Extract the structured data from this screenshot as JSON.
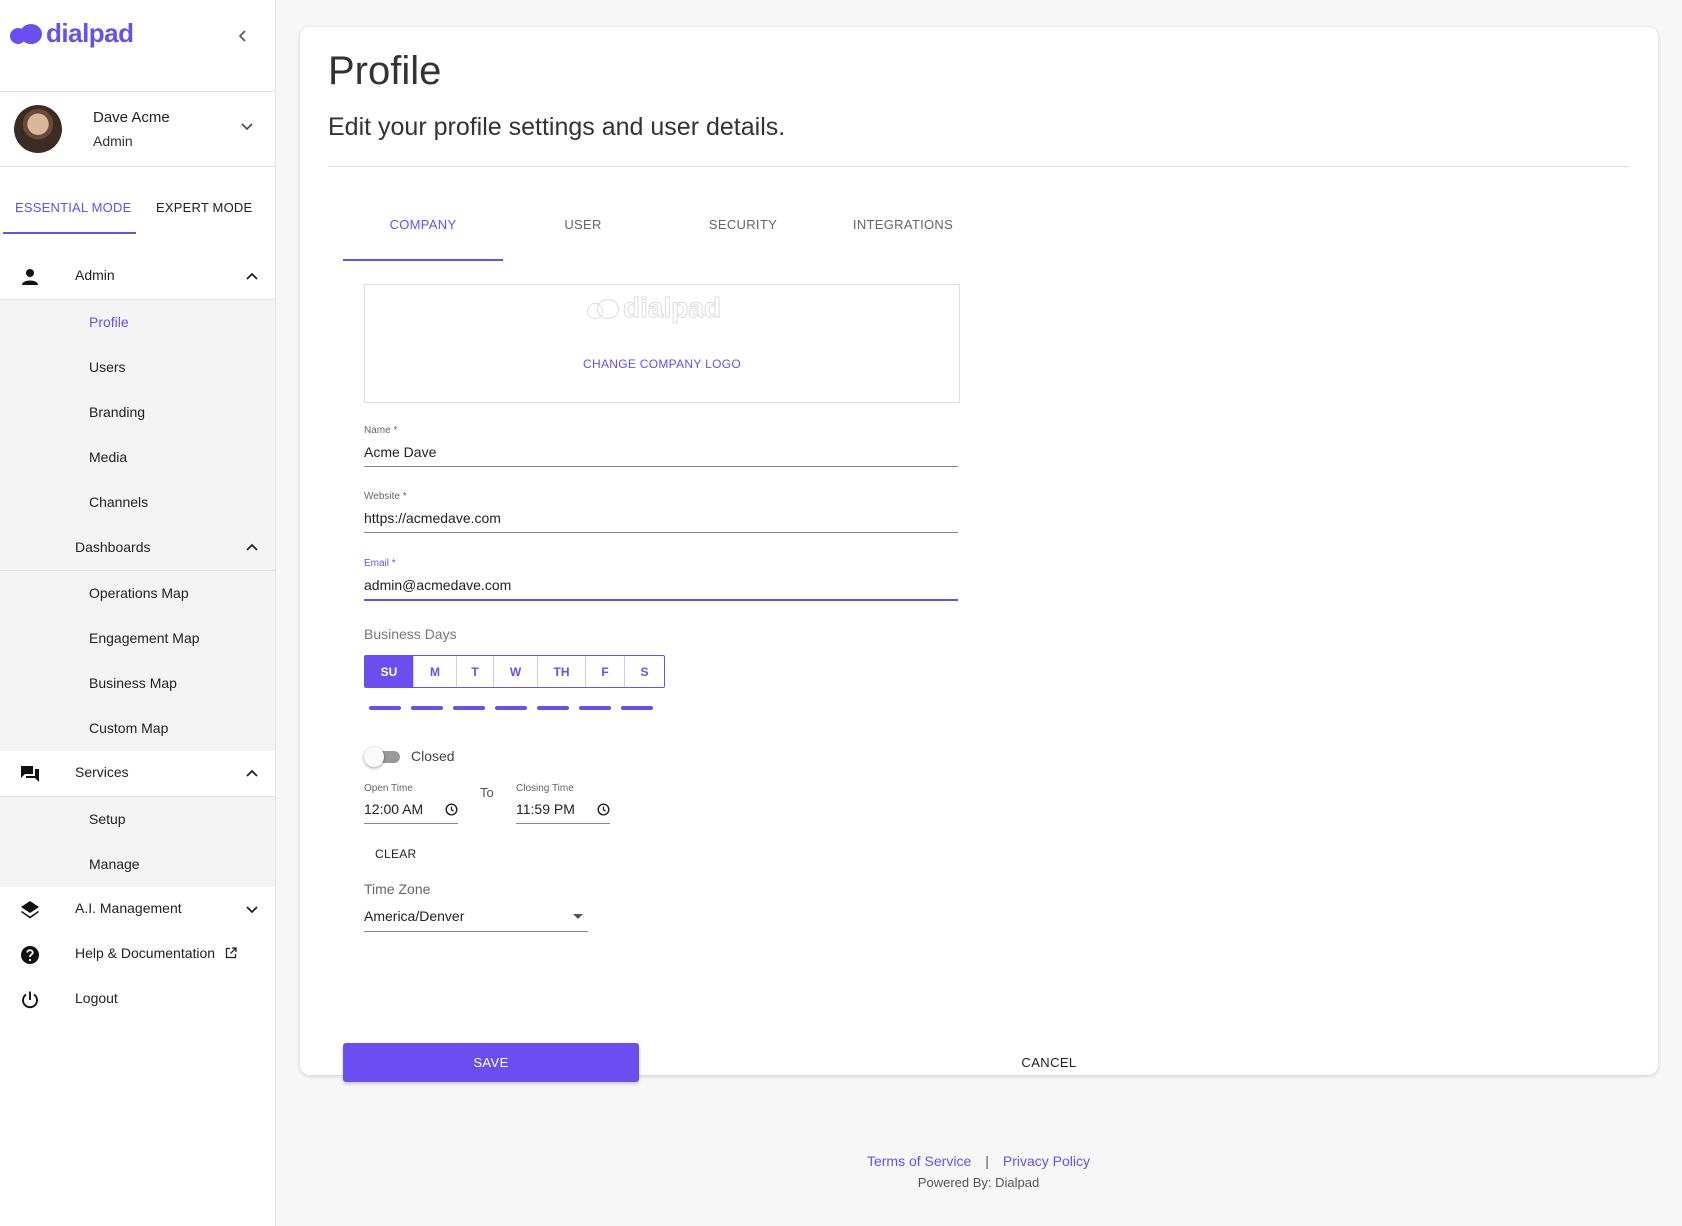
{
  "brand": {
    "name": "dialpad",
    "accent": "#6b4ef0"
  },
  "user": {
    "name": "Dave Acme",
    "role": "Admin"
  },
  "modes": {
    "essential": "ESSENTIAL MODE",
    "expert": "EXPERT MODE",
    "active": "essential"
  },
  "nav": {
    "admin": {
      "label": "Admin",
      "items": [
        "Profile",
        "Users",
        "Branding",
        "Media",
        "Channels"
      ],
      "active": "Profile",
      "dashboards": {
        "label": "Dashboards",
        "items": [
          "Operations Map",
          "Engagement Map",
          "Business Map",
          "Custom Map"
        ]
      }
    },
    "services": {
      "label": "Services",
      "items": [
        "Setup",
        "Manage"
      ]
    },
    "ai": {
      "label": "A.I. Management"
    },
    "help": {
      "label": "Help & Documentation"
    },
    "logout": {
      "label": "Logout"
    }
  },
  "page": {
    "title": "Profile",
    "subtitle": "Edit your profile settings and user details."
  },
  "tabs": [
    "COMPANY",
    "USER",
    "SECURITY",
    "INTEGRATIONS"
  ],
  "active_tab": "COMPANY",
  "company": {
    "change_logo": "CHANGE COMPANY LOGO",
    "name_label": "Name *",
    "name_value": "Acme Dave",
    "website_label": "Website *",
    "website_value": "https://acmedave.com",
    "email_label": "Email *",
    "email_value": "admin@acmedave.com",
    "business_days_label": "Business Days",
    "days": [
      "SU",
      "M",
      "T",
      "W",
      "TH",
      "F",
      "S"
    ],
    "selected_day": "SU",
    "closed_label": "Closed",
    "closed_on": false,
    "open_time_label": "Open Time",
    "open_time_value": "12:00 AM",
    "to_label": "To",
    "closing_time_label": "Closing Time",
    "closing_time_value": "11:59 PM",
    "clear_label": "CLEAR",
    "timezone_label": "Time Zone",
    "timezone_value": "America/Denver"
  },
  "actions": {
    "save": "SAVE",
    "cancel": "CANCEL"
  },
  "footer": {
    "terms": "Terms of Service",
    "separator": "|",
    "privacy": "Privacy Policy",
    "powered": "Powered By: Dialpad"
  }
}
